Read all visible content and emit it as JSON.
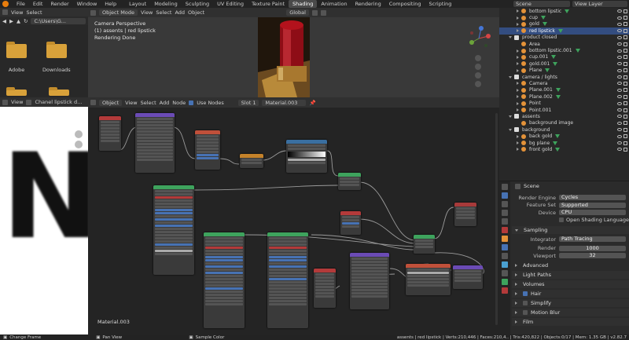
{
  "menu": [
    "File",
    "Edit",
    "Render",
    "Window",
    "Help"
  ],
  "workspaces": [
    "Layout",
    "Modeling",
    "Sculpting",
    "UV Editing",
    "Texture Paint",
    "Shading",
    "Animation",
    "Rendering",
    "Compositing",
    "Scripting"
  ],
  "active_workspace": "Shading",
  "scene_label": "Scene",
  "view_layer_label": "View Layer",
  "file_browser": {
    "view": "View",
    "select": "Select",
    "path": "C:\\Users\\G...",
    "folders": [
      "Adobe",
      "Downloads"
    ]
  },
  "viewport": {
    "mode": "Object Mode",
    "view": "View",
    "select": "Select",
    "add": "Add",
    "object": "Object",
    "orientation": "Global",
    "info_line1": "Camera Perspective",
    "info_line2": "(1) assents | red lipstick",
    "info_line3": "Rendering Done"
  },
  "image_editor": {
    "view": "View",
    "image_name": "Chanel lipstick d..."
  },
  "node_editor": {
    "type": "Object",
    "view": "View",
    "select": "Select",
    "add": "Add",
    "node": "Node",
    "use_nodes": "Use Nodes",
    "slot": "Slot 1",
    "material": "Material.003",
    "footer_label": "Material.003"
  },
  "outliner": {
    "rows": [
      {
        "indent": 2,
        "icon": "object",
        "label": "bottom lipstic",
        "toggle": "closed"
      },
      {
        "indent": 2,
        "icon": "object",
        "label": "cup",
        "toggle": "closed"
      },
      {
        "indent": 2,
        "icon": "object",
        "label": "gold",
        "toggle": "closed"
      },
      {
        "indent": 2,
        "icon": "object",
        "label": "red lipstick",
        "toggle": "closed",
        "selected": true
      },
      {
        "indent": 1,
        "icon": "collection",
        "label": "product closed",
        "toggle": "open"
      },
      {
        "indent": 2,
        "icon": "light",
        "label": "Area",
        "toggle": "none"
      },
      {
        "indent": 2,
        "icon": "object",
        "label": "bottom lipstic.001",
        "toggle": "closed"
      },
      {
        "indent": 2,
        "icon": "object",
        "label": "cup.001",
        "toggle": "closed"
      },
      {
        "indent": 2,
        "icon": "object",
        "label": "gold.001",
        "toggle": "closed"
      },
      {
        "indent": 2,
        "icon": "object",
        "label": "Plane",
        "toggle": "closed"
      },
      {
        "indent": 1,
        "icon": "collection",
        "label": "camera / lights",
        "toggle": "open"
      },
      {
        "indent": 2,
        "icon": "camera",
        "label": "Camera",
        "toggle": "closed"
      },
      {
        "indent": 2,
        "icon": "object",
        "label": "Plane.001",
        "toggle": "closed"
      },
      {
        "indent": 2,
        "icon": "object",
        "label": "Plane.002",
        "toggle": "closed"
      },
      {
        "indent": 2,
        "icon": "light",
        "label": "Point",
        "toggle": "closed"
      },
      {
        "indent": 2,
        "icon": "light",
        "label": "Point.001",
        "toggle": "closed"
      },
      {
        "indent": 1,
        "icon": "collection",
        "label": "assents",
        "toggle": "open"
      },
      {
        "indent": 2,
        "icon": "image",
        "label": "background image",
        "toggle": "none"
      },
      {
        "indent": 1,
        "icon": "collection",
        "label": "background",
        "toggle": "open"
      },
      {
        "indent": 2,
        "icon": "object",
        "label": "back gold",
        "toggle": "closed"
      },
      {
        "indent": 2,
        "icon": "object",
        "label": "bg plane",
        "toggle": "closed"
      },
      {
        "indent": 2,
        "icon": "object",
        "label": "front gold",
        "toggle": "closed"
      }
    ]
  },
  "properties": {
    "scene_title": "Scene",
    "render_engine_label": "Render Engine",
    "render_engine": "Cycles",
    "feature_set_label": "Feature Set",
    "feature_set": "Supported",
    "device_label": "Device",
    "device": "CPU",
    "osl_label": "Open Shading Language",
    "sampling": "Sampling",
    "integrator_label": "Integrator",
    "integrator": "Path Tracing",
    "render_label": "Render",
    "render_samples": "1000",
    "viewport_label": "Viewport",
    "viewport_samples": "32",
    "advanced": "Advanced",
    "light_paths": "Light Paths",
    "volumes": "Volumes",
    "hair": "Hair",
    "simplify": "Simplify",
    "motion_blur": "Motion Blur",
    "film": "Film"
  },
  "status_bar": {
    "left": "Change Frame",
    "mid1": "Pan View",
    "mid2": "Sample Color",
    "right": "assents | red lipstick | Verts:210,446 | Faces:210,4.. | Tris:420,822 | Objects:0/17 | Mem: 1.35 GB | v2.82.7"
  },
  "colors": {
    "accent": "#4772b3",
    "header_shader": "#3ea35d",
    "header_texture": "#c0503a",
    "header_converter": "#3a6fa0",
    "header_input": "#b33a3a",
    "header_vector": "#6b4bb5",
    "header_color": "#c4822a",
    "header_output": "#a83a3a",
    "header_gray": "#5a5a5a",
    "folder": "#d8a13a",
    "selected_row": "#334d80",
    "object_icon": "#e39239",
    "lipstick_red": "#b3121c"
  }
}
